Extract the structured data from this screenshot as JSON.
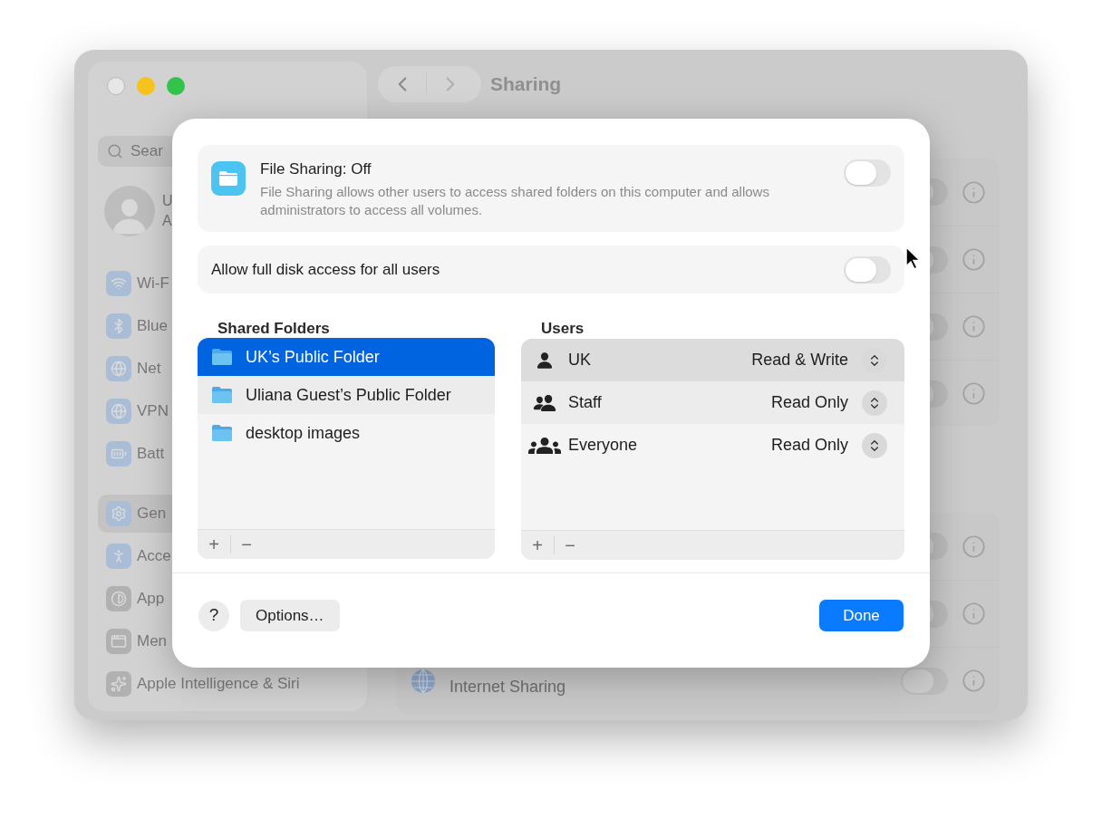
{
  "window": {
    "title": "Sharing"
  },
  "sidebar": {
    "search": {
      "placeholder": "Sear"
    },
    "profile": {
      "name": "U",
      "subtitle": "A"
    },
    "items": [
      {
        "label": "Wi-F",
        "selected": false
      },
      {
        "label": "Blue",
        "selected": false
      },
      {
        "label": "Net",
        "selected": false
      },
      {
        "label": "VPN",
        "selected": false
      },
      {
        "label": "Batt",
        "selected": false
      },
      {
        "label": "Gen",
        "selected": true
      },
      {
        "label": "Acce",
        "selected": false
      },
      {
        "label": "App",
        "selected": false
      },
      {
        "label": "Men",
        "selected": false
      },
      {
        "label": "Apple Intelligence & Siri",
        "selected": false
      }
    ]
  },
  "content": {
    "groups": [
      {
        "rows": [
          {
            "on": false
          },
          {
            "on": false
          },
          {
            "on": false
          },
          {
            "on": false
          }
        ]
      },
      {
        "rows": [
          {
            "on": false
          },
          {
            "on": false
          },
          {
            "label": "Internet Sharing",
            "on": false
          }
        ]
      }
    ]
  },
  "dialog": {
    "service": {
      "title": "File Sharing: Off",
      "description": "File Sharing allows other users to access shared folders on this computer and allows administrators to access all volumes.",
      "on": false
    },
    "full_disk_access": {
      "label": "Allow full disk access for all users",
      "on": false
    },
    "shared_folders": {
      "title": "Shared Folders",
      "add": "+",
      "remove": "−",
      "items": [
        {
          "name": "UK’s Public Folder",
          "selected": true
        },
        {
          "name": "Uliana Guest’s Public Folder",
          "selected": false
        },
        {
          "name": "desktop images",
          "selected": false
        }
      ]
    },
    "users": {
      "title": "Users",
      "add": "+",
      "remove": "−",
      "items": [
        {
          "kind": "user",
          "name": "UK",
          "permission": "Read & Write",
          "selected": true
        },
        {
          "kind": "group",
          "name": "Staff",
          "permission": "Read Only",
          "selected": false
        },
        {
          "kind": "everyone",
          "name": "Everyone",
          "permission": "Read Only",
          "selected": false
        }
      ]
    },
    "help": "?",
    "options": "Options…",
    "done": "Done"
  }
}
